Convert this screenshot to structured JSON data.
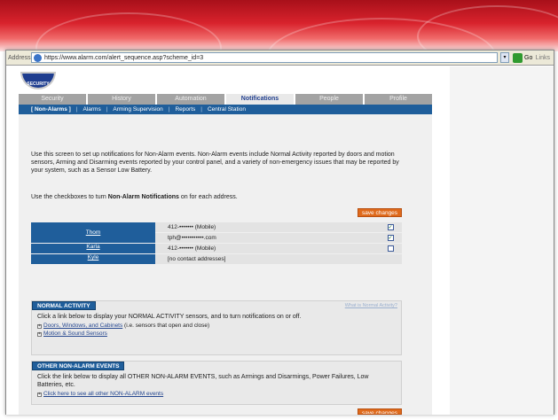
{
  "browser": {
    "address_label": "Address",
    "url": "https://www.alarm.com/alert_sequence.asp?scheme_id=3",
    "go_label": "Go",
    "links_label": "Links"
  },
  "logo_text": "SECURITY",
  "tabs": [
    {
      "label": "Security",
      "active": false
    },
    {
      "label": "History",
      "active": false
    },
    {
      "label": "Automation",
      "active": false
    },
    {
      "label": "Notifications",
      "active": true
    },
    {
      "label": "People",
      "active": false
    },
    {
      "label": "Profile",
      "active": false
    }
  ],
  "subnav": [
    {
      "label": "[ Non-Alarms ]",
      "active": true
    },
    {
      "label": "Alarms",
      "active": false
    },
    {
      "label": "Arming Supervision",
      "active": false
    },
    {
      "label": "Reports",
      "active": false
    },
    {
      "label": "Central Station",
      "active": false
    }
  ],
  "intro_text": "Use this screen to set up notifications for Non-Alarm events. Non-Alarm events include Normal Activity reported by doors and motion sensors, Arming and Disarming events reported by your control panel, and a variety of non-emergency issues that may be reported by your system, such as a Sensor Low Battery.",
  "instruction_prefix": "Use the checkboxes to turn",
  "instruction_bold": "Non-Alarm Notifications",
  "instruction_suffix": "on for each address.",
  "save_label": "save changes",
  "contacts": [
    {
      "name": "Thom",
      "addresses": [
        {
          "value": "412-••••••• (Mobile)",
          "checked": true
        },
        {
          "value": "tph@•••••••••••.com",
          "checked": true
        }
      ]
    },
    {
      "name": "Karla",
      "addresses": [
        {
          "value": "412-••••••• (Mobile)",
          "checked": false
        }
      ]
    },
    {
      "name": "Kyle",
      "addresses": [
        {
          "value": "[no contact addresses]",
          "checked": null
        }
      ]
    }
  ],
  "normal_activity": {
    "title": "NORMAL ACTIVITY",
    "help_link": "What is Normal Activity?",
    "description": "Click a link below to display your NORMAL ACTIVITY sensors, and to turn notifications on or off.",
    "link1": "Doors, Windows, and Cabinets",
    "link1_suffix": " (i.e. sensors that open and close)",
    "link2": "Motion & Sound Sensors"
  },
  "other_events": {
    "title": "OTHER NON-ALARM EVENTS",
    "description": "Click the link below to display all OTHER NON-ALARM EVENTS, such as Armings and Disarmings, Power Failures, Low Batteries, etc.",
    "link": "Click here to see all other NON-ALARM events"
  },
  "colors": {
    "banner_red": "#d8222c",
    "nav_blue": "#1f5e9b",
    "save_orange": "#df6a1c"
  }
}
